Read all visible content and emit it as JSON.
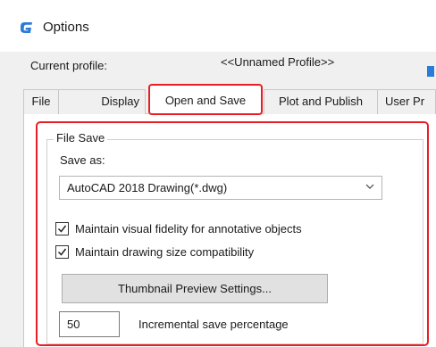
{
  "window": {
    "title": "Options",
    "icon": "app-logo-icon"
  },
  "profile": {
    "label": "Current profile:",
    "value": "<<Unnamed Profile>>"
  },
  "tabs": [
    {
      "label": "File",
      "active": false
    },
    {
      "label": "Display",
      "active": false
    },
    {
      "label": "Open and Save",
      "active": true
    },
    {
      "label": "Plot and Publish",
      "active": false
    },
    {
      "label": "User Pr",
      "active": false
    }
  ],
  "file_save": {
    "group_title": "File Save",
    "save_as_label": "Save as:",
    "save_as_value": "AutoCAD 2018 Drawing(*.dwg)",
    "options": [
      {
        "label": "Maintain visual fidelity for annotative objects",
        "checked": true
      },
      {
        "label": "Maintain drawing size compatibility",
        "checked": true
      }
    ],
    "thumbnail_button": "Thumbnail Preview Settings...",
    "incremental_value": "50",
    "incremental_label": "Incremental save percentage"
  },
  "colors": {
    "highlight": "#e81e25",
    "accent": "#2b7bd9"
  }
}
